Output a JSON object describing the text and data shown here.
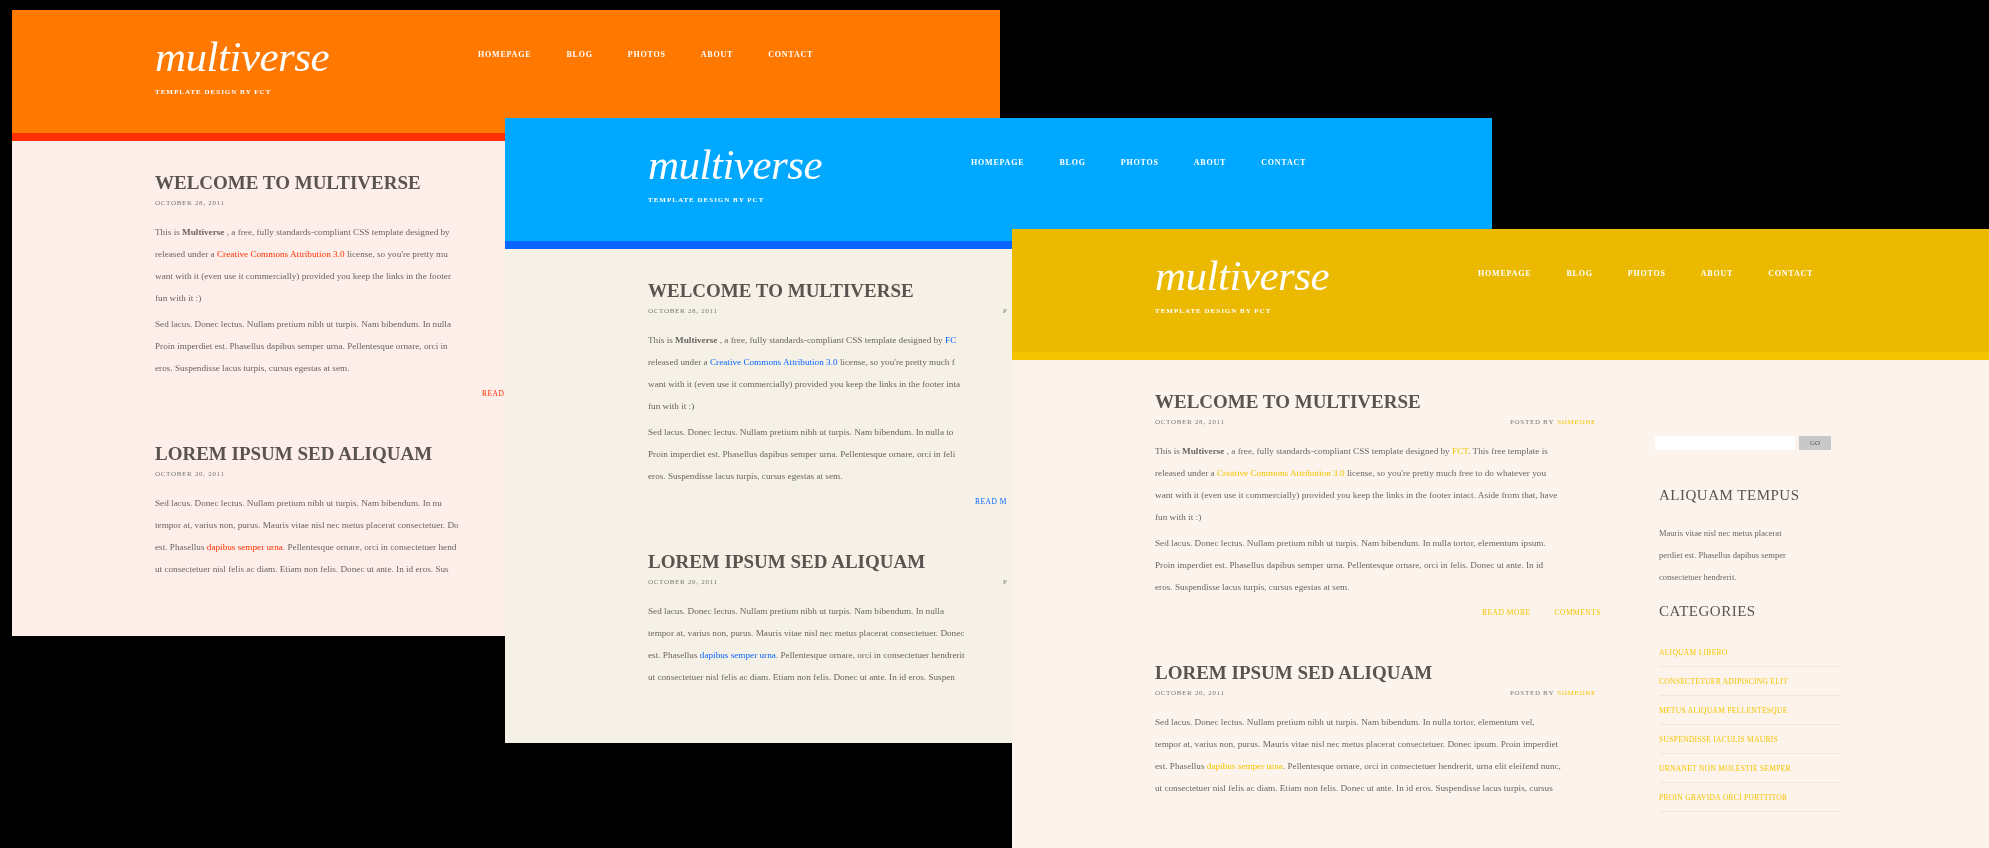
{
  "pages": [
    {
      "color": "#ff7800",
      "stripe": {
        "color": "#ff3000"
      },
      "content": {
        "color": "#fdeee9"
      },
      "logo": "multiverse",
      "tagline": "TEMPLATE DESIGN BY FCT",
      "nav": [
        "HOMEPAGE",
        "BLOG",
        "PHOTOS",
        "ABOUT",
        "CONTACT"
      ],
      "posts": [
        {
          "title": "WELCOME TO MULTIVERSE",
          "date": "OCTOBER 28, 2011",
          "paragraphs": [
            [
              [
                {
                  "text": "This is **Multiverse** , a free, fully standards-compliant CSS template designed by"
                }
              ],
              [
                {
                  "text": "released under a "
                },
                {
                  "link": "Creative Commons Attribution 3.0"
                },
                {
                  "text": " license, so you're pretty mu"
                }
              ],
              [
                {
                  "text": "want with it (even use it commercially) provided you keep the links in the footer"
                }
              ],
              [
                {
                  "text": "fun with it :)"
                }
              ]
            ],
            [
              [
                {
                  "text": "Sed lacus. Donec lectus. Nullam pretium nibh ut turpis. Nam bibendum. In nulla"
                }
              ],
              [
                {
                  "text": "Proin imperdiet est. Phasellus dapibus semper urna. Pellentesque ornare, orci in"
                }
              ],
              [
                {
                  "text": "eros. Suspendisse lacus turpis, cursus egestas at sem."
                }
              ]
            ]
          ],
          "links": [
            "READ"
          ]
        },
        {
          "title": "LOREM IPSUM SED ALIQUAM",
          "date": "OCTOBER 20, 2011",
          "paragraphs": [
            [
              [
                {
                  "text": "Sed lacus. Donec lectus. Nullam pretium nibh ut turpis. Nam bibendum. In nu"
                }
              ],
              [
                {
                  "text": "tempor at, varius non, purus. Mauris vitae nisl nec metus placerat consectetuer. Do"
                }
              ],
              [
                {
                  "text": "est. Phasellus "
                },
                {
                  "link": "dapibus semper urna"
                },
                {
                  "text": ". Pellentesque ornare, orci in consectetuer hend"
                }
              ],
              [
                {
                  "text": "ut consectetuer nisl felis ac diam. Etiam non felis. Donec ut ante. In id eros. Sus"
                }
              ]
            ]
          ]
        }
      ]
    },
    {
      "color": "#00a8ff",
      "stripe": {
        "color": "#0a66ff"
      },
      "content": {
        "color": "#f5f1e6"
      },
      "logo": "multiverse",
      "tagline": "TEMPLATE DESIGN BY PCT",
      "nav": [
        "HOMEPAGE",
        "BLOG",
        "PHOTOS",
        "ABOUT",
        "CONTACT"
      ],
      "posts": [
        {
          "title": "WELCOME TO MULTIVERSE",
          "date": "OCTOBER 28, 2011",
          "byline": {
            "label": "P"
          },
          "paragraphs": [
            [
              [
                {
                  "text": "This is **Multiverse** , a free, fully standards-compliant CSS template designed by "
                },
                {
                  "link": "FC"
                }
              ],
              [
                {
                  "text": "released under a "
                },
                {
                  "link": "Creative Commons Attribution 3.0"
                },
                {
                  "text": " license, so you're pretty much f"
                }
              ],
              [
                {
                  "text": "want with it (even use it commercially) provided you keep the links in the footer inta"
                }
              ],
              [
                {
                  "text": "fun with it :)"
                }
              ]
            ],
            [
              [
                {
                  "text": "Sed lacus. Donec lectus. Nullam pretium nibh ut turpis. Nam bibendum. In nulla to"
                }
              ],
              [
                {
                  "text": "Proin imperdiet est. Phasellus dapibus semper urna. Pellentesque ornare, orci in feli"
                }
              ],
              [
                {
                  "text": "eros. Suspendisse lacus turpis, cursus egestas at sem."
                }
              ]
            ]
          ],
          "links": [
            "READ M"
          ]
        },
        {
          "title": "LOREM IPSUM SED ALIQUAM",
          "date": "OCTOBER 20, 2011",
          "byline": {
            "label": "P"
          },
          "paragraphs": [
            [
              [
                {
                  "text": "Sed lacus. Donec lectus. Nullam pretium nibh ut turpis. Nam bibendum. In nulla"
                }
              ],
              [
                {
                  "text": "tempor at, varius non, purus. Mauris vitae nisl nec metus placerat consectetuer. Donec"
                }
              ],
              [
                {
                  "text": "est. Phasellus "
                },
                {
                  "link": "dapibus semper urna"
                },
                {
                  "text": ". Pellentesque ornare, orci in consectetuer hendrerit"
                }
              ],
              [
                {
                  "text": "ut consectetuer nisl felis ac diam. Etiam non felis. Donec ut ante. In id eros. Suspen"
                }
              ]
            ]
          ]
        }
      ]
    },
    {
      "color": "#ebb900",
      "stripe": {
        "color": "#f3c400"
      },
      "content": {
        "color": "#fcf4ec"
      },
      "logo": "multiverse",
      "tagline": "TEMPLATE DESIGN BY PCT",
      "nav": [
        "HOMEPAGE",
        "BLOG",
        "PHOTOS",
        "ABOUT",
        "CONTACT"
      ],
      "posts": [
        {
          "title": "WELCOME TO MULTIVERSE",
          "date": "OCTOBER 28, 2011",
          "byline": {
            "label": "POSTED BY",
            "author": "SOMEONE"
          },
          "paragraphs": [
            [
              [
                {
                  "text": "This is **Multiverse** , a free, fully standards-compliant CSS template designed by "
                },
                {
                  "link": "FCT"
                },
                {
                  "text": ". This free template is"
                }
              ],
              [
                {
                  "text": "released under a "
                },
                {
                  "link": "Creative Commons Attribution 3.0"
                },
                {
                  "text": " license, so you're pretty much free to do whatever you"
                }
              ],
              [
                {
                  "text": "want with it (even use it commercially) provided you keep the links in the footer intact. Aside from that, have"
                }
              ],
              [
                {
                  "text": "fun with it :)"
                }
              ]
            ],
            [
              [
                {
                  "text": "Sed lacus. Donec lectus. Nullam pretium nibh ut turpis. Nam bibendum. In nulla tortor, elementum ipsum."
                }
              ],
              [
                {
                  "text": "Proin imperdiet est. Phasellus dapibus semper urna. Pellentesque ornare, orci in felis. Donec ut ante. In id"
                }
              ],
              [
                {
                  "text": "eros. Suspendisse lacus turpis, cursus egestas at sem."
                }
              ]
            ]
          ],
          "links": [
            "READ MORE",
            "COMMENTS"
          ]
        },
        {
          "title": "LOREM IPSUM SED ALIQUAM",
          "date": "OCTOBER 20, 2011",
          "byline": {
            "label": "POSTED BY",
            "author": "SOMEONE"
          },
          "paragraphs": [
            [
              [
                {
                  "text": "Sed lacus. Donec lectus. Nullam pretium nibh ut turpis. Nam bibendum. In nulla tortor, elementum vel,"
                }
              ],
              [
                {
                  "text": "tempor at, varius non, purus. Mauris vitae nisl nec metus placerat consectetuer. Donec ipsum. Proin imperdiet"
                }
              ],
              [
                {
                  "text": "est. Phasellus "
                },
                {
                  "link": "dapibus semper urna"
                },
                {
                  "text": ". Pellentesque ornare, orci in consectetuer hendrerit, urna elit eleifend nunc,"
                }
              ],
              [
                {
                  "text": "ut consectetuer nisl felis ac diam. Etiam non felis. Donec ut ante. In id eros. Suspendisse lacus turpis, cursus"
                }
              ]
            ]
          ]
        }
      ],
      "sidebar": {
        "search_button": "GO",
        "sections": [
          {
            "kind": "text",
            "title": "ALIQUAM TEMPUS",
            "lines": [
              "Mauris vitae nisl nec metus placerat",
              "perdiet est. Phasellus dapibus semper",
              "consectetuer hendrerit."
            ]
          },
          {
            "kind": "list",
            "title": "CATEGORIES",
            "items": [
              "ALIQUAM LIBERO",
              "CONSECTETUER ADIPISCING ELIT",
              "METUS ALIQUAM PELLENTESQUE",
              "SUSPENDISSE IACULIS MAURIS",
              "URNANET NON MOLESTIE SEMPER",
              "PROIN GRAVIDA ORCI PORTTITOR"
            ]
          }
        ]
      }
    }
  ]
}
